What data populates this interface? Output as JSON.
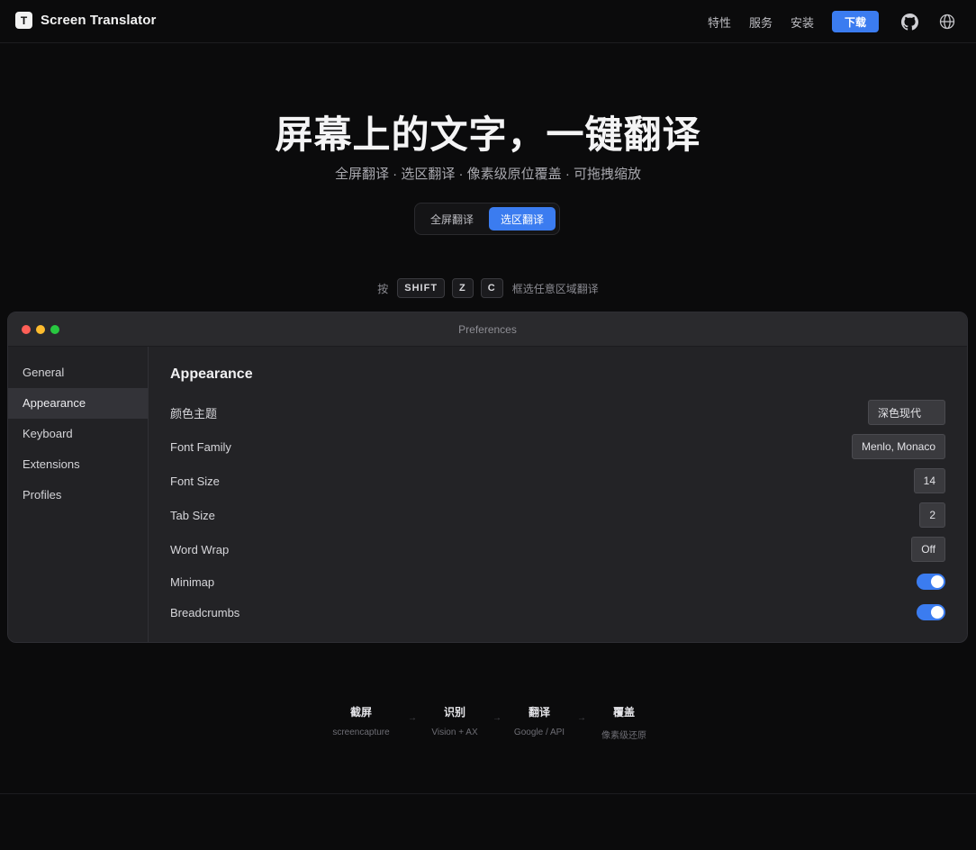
{
  "brand": {
    "logo_letter": "T",
    "name": "Screen Translator"
  },
  "nav": {
    "links": [
      "特性",
      "服务",
      "安装"
    ],
    "download": "下载",
    "icons": [
      "github-icon",
      "globe-icon"
    ]
  },
  "hero": {
    "title": "屏幕上的文字，一键翻译",
    "subtitle": "全屏翻译 · 选区翻译 · 像素级原位覆盖 · 可拖拽缩放",
    "modes": [
      "全屏翻译",
      "选区翻译"
    ],
    "active_mode": "选区翻译"
  },
  "hint": {
    "prefix": "按",
    "keys": [
      "SHIFT",
      "Z",
      "C"
    ],
    "suffix": "框选任意区域翻译"
  },
  "window": {
    "title": "Preferences",
    "traffic_colors": [
      "#ff5f57",
      "#febc2e",
      "#28c840"
    ],
    "sidebar": [
      "General",
      "Appearance",
      "Keyboard",
      "Extensions",
      "Profiles"
    ],
    "active_sidebar": "Appearance",
    "section_title": "Appearance",
    "settings": [
      {
        "label": "颜色主题",
        "value": "深色现代",
        "kind": "select"
      },
      {
        "label": "Font Family",
        "value": "Menlo, Monaco",
        "kind": "select"
      },
      {
        "label": "Font Size",
        "value": "14",
        "kind": "input"
      },
      {
        "label": "Tab Size",
        "value": "2",
        "kind": "input"
      },
      {
        "label": "Word Wrap",
        "value": "Off",
        "kind": "select"
      },
      {
        "label": "Minimap",
        "value": true,
        "kind": "toggle"
      },
      {
        "label": "Breadcrumbs",
        "value": true,
        "kind": "toggle"
      }
    ]
  },
  "pipeline": [
    {
      "title": "截屏",
      "sub": "screencapture"
    },
    {
      "title": "识别",
      "sub": "Vision + AX"
    },
    {
      "title": "翻译",
      "sub": "Google / API"
    },
    {
      "title": "覆盖",
      "sub": "像素级还原"
    }
  ],
  "colors": {
    "accent": "#3b7cf0",
    "background": "#0b0b0c",
    "panel": "#232326"
  }
}
